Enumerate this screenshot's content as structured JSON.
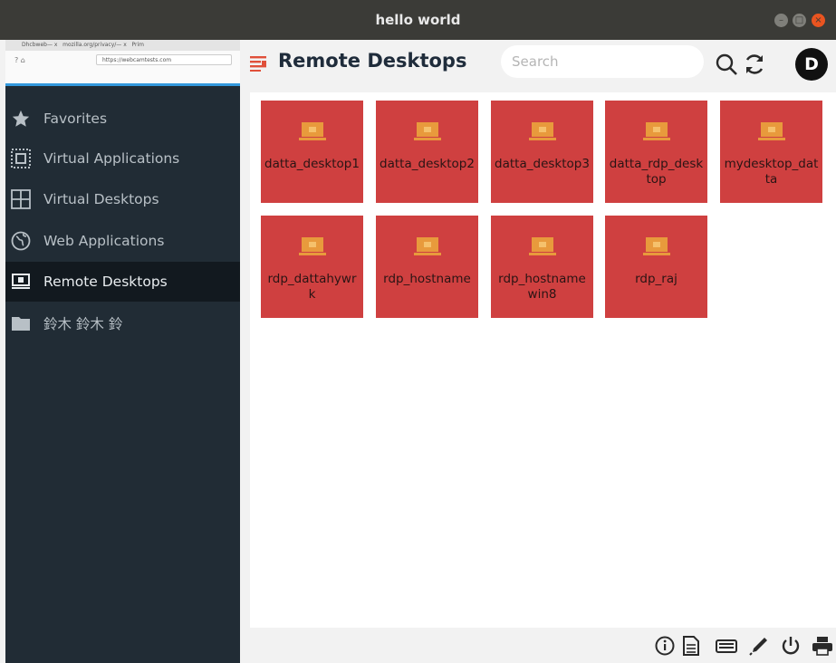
{
  "window": {
    "title": "hello world"
  },
  "thumbnail": {
    "tab1": "Dhcbweb— x",
    "tab2": "mozilla.org/privacy/— x",
    "tab3": "Prim",
    "url": "https://webcamtests.com"
  },
  "sidebar": {
    "items": [
      {
        "label": "Favorites",
        "icon": "star-icon"
      },
      {
        "label": "Virtual Applications",
        "icon": "app-grid-icon"
      },
      {
        "label": "Virtual Desktops",
        "icon": "desktop-grid-icon"
      },
      {
        "label": "Web Applications",
        "icon": "globe-icon"
      },
      {
        "label": "Remote Desktops",
        "icon": "monitor-icon",
        "active": true
      },
      {
        "label": "鈴木 鈴木 鈴",
        "icon": "folder-icon"
      }
    ]
  },
  "header": {
    "title": "Remote Desktops",
    "search_placeholder": "Search",
    "avatar_letter": "D"
  },
  "tiles": [
    {
      "label": "datta_desktop1"
    },
    {
      "label": "datta_desktop2"
    },
    {
      "label": "datta_desktop3"
    },
    {
      "label": "datta_rdp_desktop"
    },
    {
      "label": "mydesktop_datta"
    },
    {
      "label": "rdp_dattahywrk"
    },
    {
      "label": "rdp_hostname"
    },
    {
      "label": "rdp_hostnamewin8"
    },
    {
      "label": "rdp_raj"
    }
  ],
  "colors": {
    "accent": "#cf4040",
    "sidebar_bg": "#212c35",
    "sidebar_active": "#12191f",
    "title_bar": "#3b3b37",
    "close_button": "#e95420"
  },
  "footer": {
    "icons": [
      "info-icon",
      "document-icon",
      "keyboard-icon",
      "pen-icon",
      "power-icon",
      "printer-icon"
    ]
  }
}
